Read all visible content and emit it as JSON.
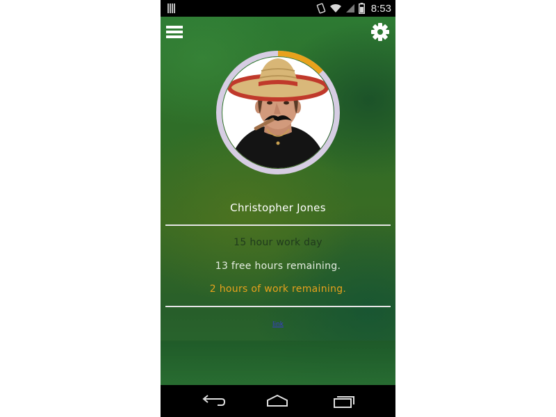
{
  "status_bar": {
    "time": "8:53",
    "icons": [
      "notification-icon",
      "rotate-icon",
      "wifi-icon",
      "cell-signal-icon",
      "battery-icon"
    ]
  },
  "header": {
    "menu_icon": "hamburger-menu-icon",
    "settings_icon": "gear-icon"
  },
  "profile": {
    "name": "Christopher Jones",
    "work_progress": 0.13,
    "ring_color": "#d6cde3",
    "progress_color": "#e8a21c"
  },
  "summary": {
    "work_day": "15 hour work day",
    "free_hours": "13 free hours remaining.",
    "work_remaining": "2 hours of work remaining."
  },
  "link": {
    "label": "link"
  },
  "nav_bar": {
    "icons": [
      "back-icon",
      "home-icon",
      "recent-apps-icon"
    ]
  },
  "colors": {
    "accent": "#e8a21c",
    "background": "#2f6e28"
  }
}
